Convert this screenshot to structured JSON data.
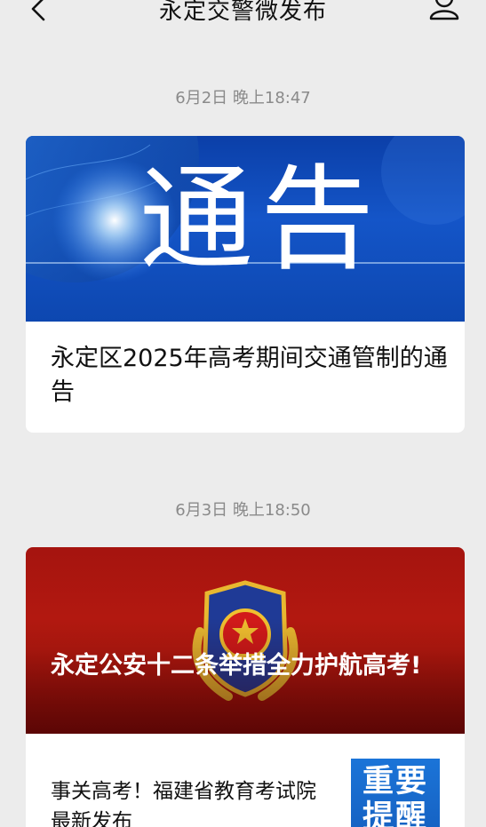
{
  "navbar": {
    "title": "永定交警微发布",
    "back_icon": "chevron-left-icon",
    "profile_icon": "person-icon"
  },
  "messages": [
    {
      "timestamp": "6月2日 晚上18:47",
      "banner_text": "通告",
      "title": "永定区2025年高考期间交通管制的通告"
    },
    {
      "timestamp": "6月3日 晚上18:50",
      "banner_title": "永定公安十二条举措全力护航高考!",
      "sub_items": [
        {
          "title": "事关高考！福建省教育考试院最新发布",
          "thumb_text": "重要提醒"
        }
      ]
    }
  ],
  "colors": {
    "background": "#ececec",
    "banner_blue": "#1455c8",
    "banner_red": "#b81a10",
    "thumb_blue": "#1b74d8",
    "timestamp_gray": "#8a8a8a"
  }
}
